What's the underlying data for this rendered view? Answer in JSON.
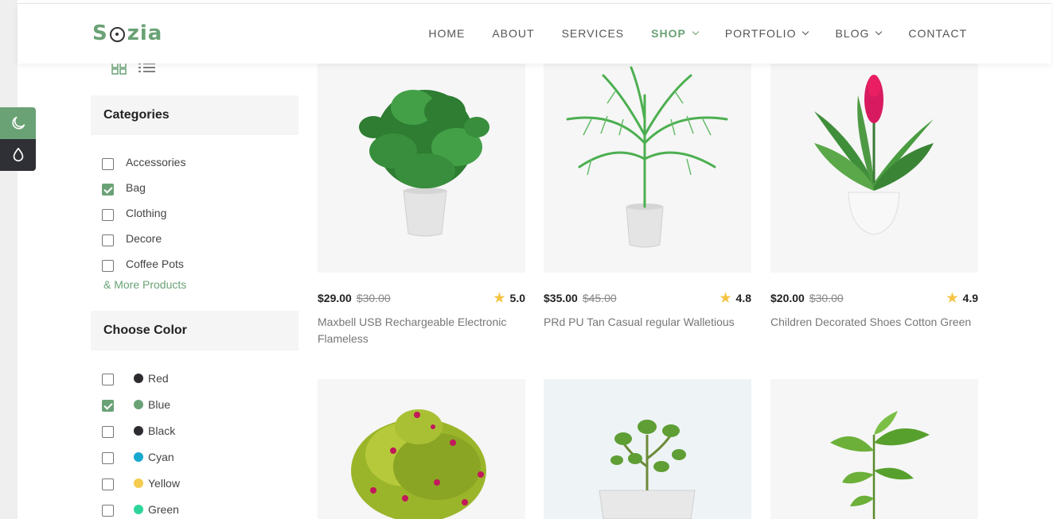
{
  "header": {
    "logo_text": {
      "s": "S",
      "rest": "zia"
    },
    "nav": [
      {
        "label": "HOME",
        "dropdown": false,
        "active": false
      },
      {
        "label": "ABOUT",
        "dropdown": false,
        "active": false
      },
      {
        "label": "SERVICES",
        "dropdown": false,
        "active": false
      },
      {
        "label": "SHOP",
        "dropdown": true,
        "active": true
      },
      {
        "label": "PORTFOLIO",
        "dropdown": true,
        "active": false
      },
      {
        "label": "BLOG",
        "dropdown": true,
        "active": false
      },
      {
        "label": "CONTACT",
        "dropdown": false,
        "active": false
      }
    ]
  },
  "theme_switcher": {
    "light_icon": "moon-icon",
    "dark_icon": "droplet-icon"
  },
  "sidebar": {
    "view_toggle": {
      "grid_icon": "grid-view-icon",
      "list_icon": "list-view-icon"
    },
    "categories": {
      "title": "Categories",
      "items": [
        {
          "label": "Accessories",
          "checked": false
        },
        {
          "label": "Bag",
          "checked": true
        },
        {
          "label": "Clothing",
          "checked": false
        },
        {
          "label": "Decore",
          "checked": false
        },
        {
          "label": "Coffee Pots",
          "checked": false
        }
      ],
      "more_link": "& More Products"
    },
    "colors": {
      "title": "Choose Color",
      "items": [
        {
          "label": "Red",
          "checked": false,
          "swatch": "#2d2a30"
        },
        {
          "label": "Blue",
          "checked": true,
          "swatch": "#6aa276"
        },
        {
          "label": "Black",
          "checked": false,
          "swatch": "#2d2a30"
        },
        {
          "label": "Cyan",
          "checked": false,
          "swatch": "#16a8cf"
        },
        {
          "label": "Yellow",
          "checked": false,
          "swatch": "#f5cc4f"
        },
        {
          "label": "Green",
          "checked": false,
          "swatch": "#2ed59a"
        }
      ]
    }
  },
  "products": [
    {
      "price": "$29.00",
      "old_price": "$30.00",
      "rating": "5.0",
      "name": "Maxbell USB Rechargeable Electronic Flameless",
      "image": "monstera-plant-image"
    },
    {
      "price": "$35.00",
      "old_price": "$45.00",
      "rating": "4.8",
      "name": "PRd PU Tan Casual regular Walletious",
      "image": "palm-plant-image"
    },
    {
      "price": "$20.00",
      "old_price": "$30.00",
      "rating": "4.9",
      "name": "Children Decorated Shoes Cotton Green",
      "image": "red-ginger-plant-image"
    },
    {
      "image": "flowering-bush-image"
    },
    {
      "image": "jade-plant-image"
    },
    {
      "image": "leafy-branch-image"
    }
  ],
  "colors": {
    "accent": "#6aa276",
    "dark": "#2f3035",
    "star": "#f5c443"
  }
}
